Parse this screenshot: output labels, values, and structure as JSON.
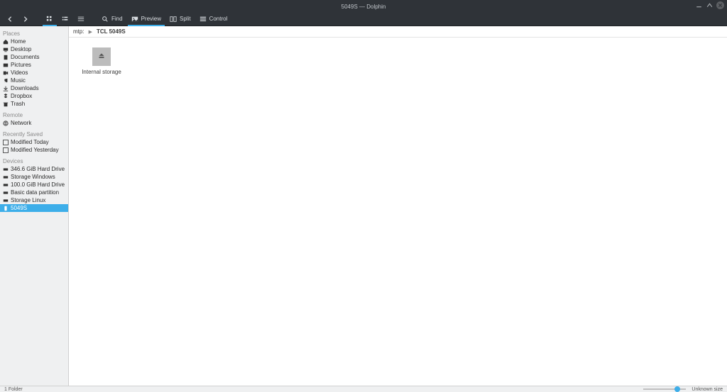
{
  "window": {
    "title": "5049S — Dolphin"
  },
  "toolbar": {
    "back": "",
    "forward": "",
    "view_icons": "",
    "view_compact": "",
    "view_details": "",
    "find": "Find",
    "preview": "Preview",
    "split": "Split",
    "control": "Control"
  },
  "breadcrumb": {
    "segment0": "mtp:",
    "segment1": "TCL 5049S"
  },
  "sidebar": {
    "places_header": "Places",
    "places": {
      "home": "Home",
      "desktop": "Desktop",
      "documents": "Documents",
      "pictures": "Pictures",
      "videos": "Videos",
      "music": "Music",
      "downloads": "Downloads",
      "dropbox": "Dropbox",
      "trash": "Trash"
    },
    "remote_header": "Remote",
    "remote": {
      "network": "Network"
    },
    "recent_header": "Recently Saved",
    "recent": {
      "today": "Modified Today",
      "yesterday": "Modified Yesterday"
    },
    "devices_header": "Devices",
    "devices": {
      "d0": "346.6 GiB Hard Drive",
      "d1": "Storage Windows",
      "d2": "100.0 GiB Hard Drive",
      "d3": "Basic data partition",
      "d4": "Storage Linux",
      "d5": "5049S"
    }
  },
  "files": {
    "item0": {
      "label": "Internal storage"
    }
  },
  "status": {
    "count": "1 Folder",
    "size": "Unknown size"
  }
}
